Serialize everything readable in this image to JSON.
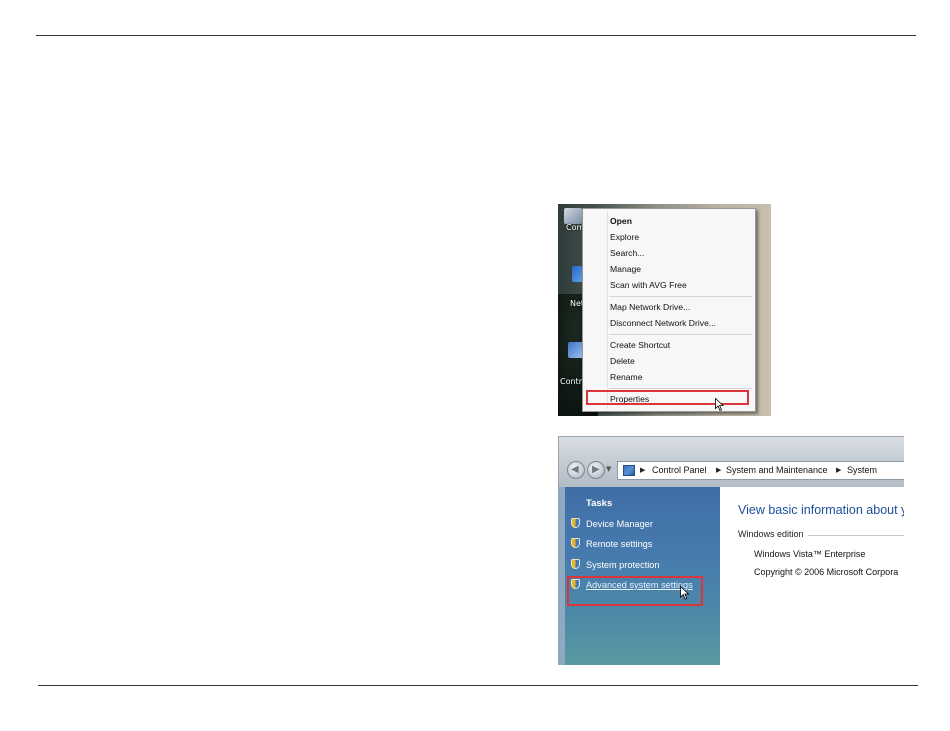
{
  "context_menu": {
    "desktop_labels": [
      "Com",
      "Net",
      "Contro"
    ],
    "groups": [
      [
        {
          "label": "Open",
          "bold": true
        },
        {
          "label": "Explore"
        },
        {
          "label": "Search..."
        },
        {
          "label": "Manage"
        },
        {
          "label": "Scan with AVG Free"
        }
      ],
      [
        {
          "label": "Map Network Drive..."
        },
        {
          "label": "Disconnect Network Drive..."
        }
      ],
      [
        {
          "label": "Create Shortcut"
        },
        {
          "label": "Delete"
        },
        {
          "label": "Rename"
        }
      ],
      [
        {
          "label": "Properties",
          "highlighted": true
        }
      ]
    ],
    "highlight_color": "#d9353a"
  },
  "system_window": {
    "address": {
      "crumbs": [
        "Control Panel",
        "System and Maintenance",
        "System"
      ]
    },
    "sidebar": {
      "title": "Tasks",
      "items": [
        {
          "label": "Device Manager",
          "icon": "uac-shield-icon"
        },
        {
          "label": "Remote settings",
          "icon": "uac-shield-icon"
        },
        {
          "label": "System protection",
          "icon": "uac-shield-icon"
        },
        {
          "label": "Advanced system settings",
          "icon": "uac-shield-icon",
          "highlighted": true
        }
      ]
    },
    "content": {
      "title": "View basic information about y",
      "section": "Windows edition",
      "lines": [
        "Windows Vista™ Enterprise",
        "Copyright © 2006 Microsoft Corpora"
      ]
    },
    "accent_color": "#1e4f9c"
  }
}
